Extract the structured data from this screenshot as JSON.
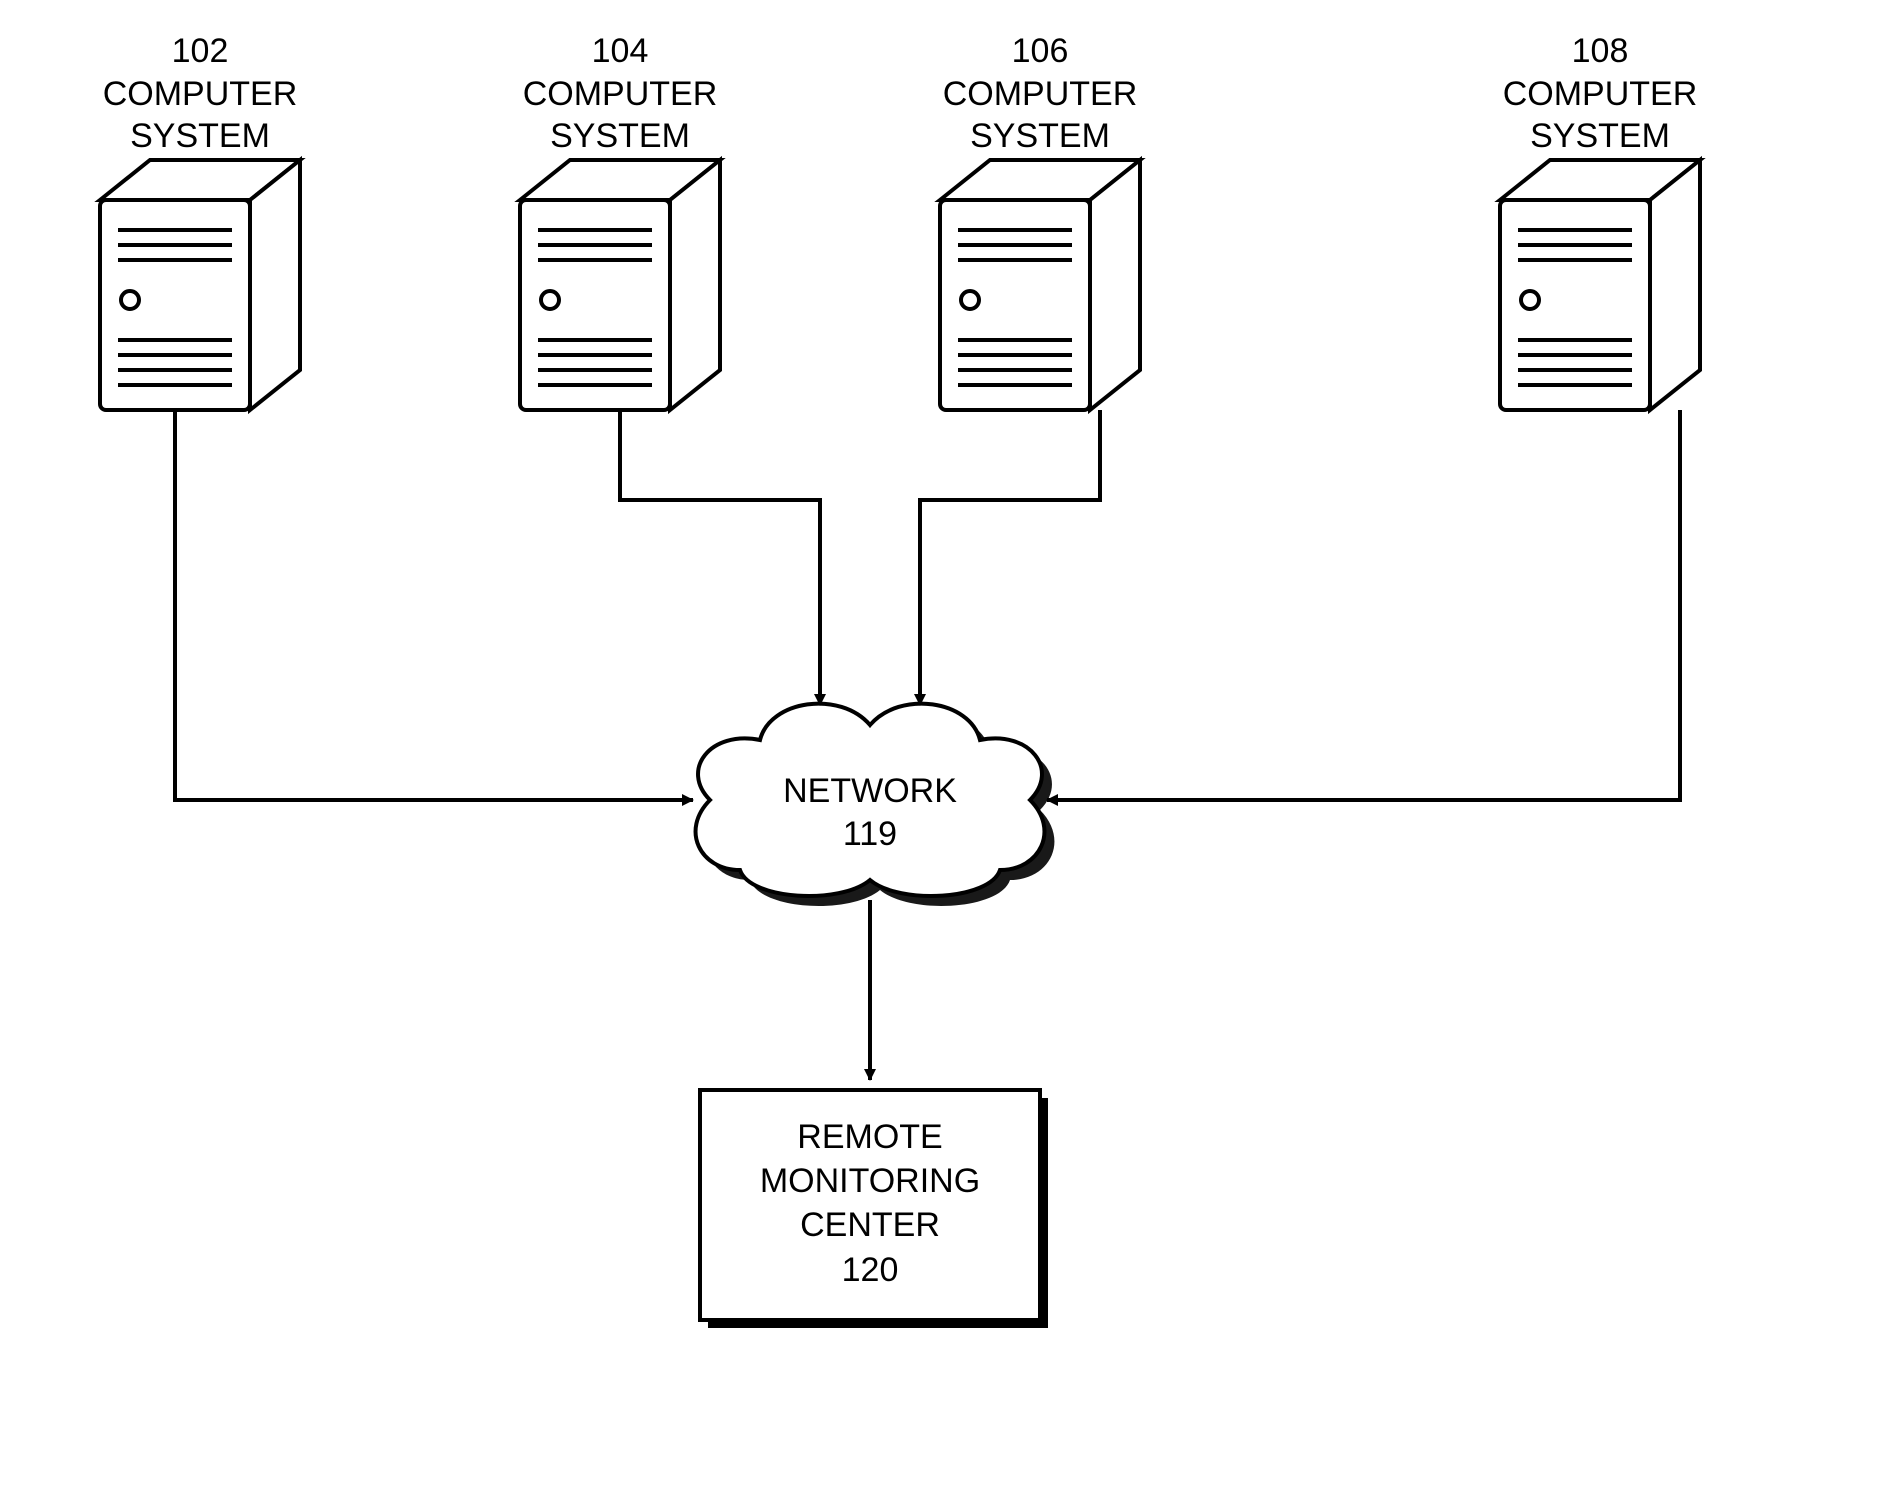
{
  "nodes": {
    "cs102": {
      "id": "102",
      "label": "COMPUTER\nSYSTEM"
    },
    "cs104": {
      "id": "104",
      "label": "COMPUTER\nSYSTEM"
    },
    "cs106": {
      "id": "106",
      "label": "COMPUTER\nSYSTEM"
    },
    "cs108": {
      "id": "108",
      "label": "COMPUTER\nSYSTEM"
    },
    "network": {
      "label": "NETWORK",
      "id": "119"
    },
    "rmc": {
      "line1": "REMOTE",
      "line2": "MONITORING",
      "line3": "CENTER",
      "id": "120"
    }
  }
}
